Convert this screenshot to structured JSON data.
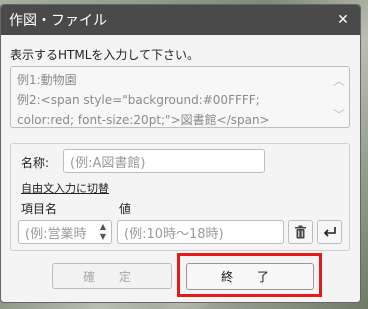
{
  "dialog": {
    "title": "作図・ファイル",
    "close_glyph": "✕"
  },
  "instructions": "表示するHTMLを入力して下さい。",
  "html_textarea": {
    "lines": [
      "例1:動物園",
      "例2:<span style=\"background:#00FFFF;",
      "color:red; font-size:20pt;\">図書館</span>"
    ]
  },
  "fields": {
    "name_label": "名称:",
    "name_placeholder": "(例:A図書館)",
    "free_input_link": "自由文入力に切替",
    "item_label": "項目名",
    "value_label": "値",
    "item_placeholder": "(例:営業時",
    "value_placeholder": "(例:10時～18時)"
  },
  "buttons": {
    "confirm": "確 定",
    "finish": "終 了"
  },
  "icons": {
    "delete": "trash-icon",
    "enter": "enter-icon"
  },
  "colors": {
    "titlebar": "#4a4a4a",
    "highlight": "#e31b1b"
  }
}
